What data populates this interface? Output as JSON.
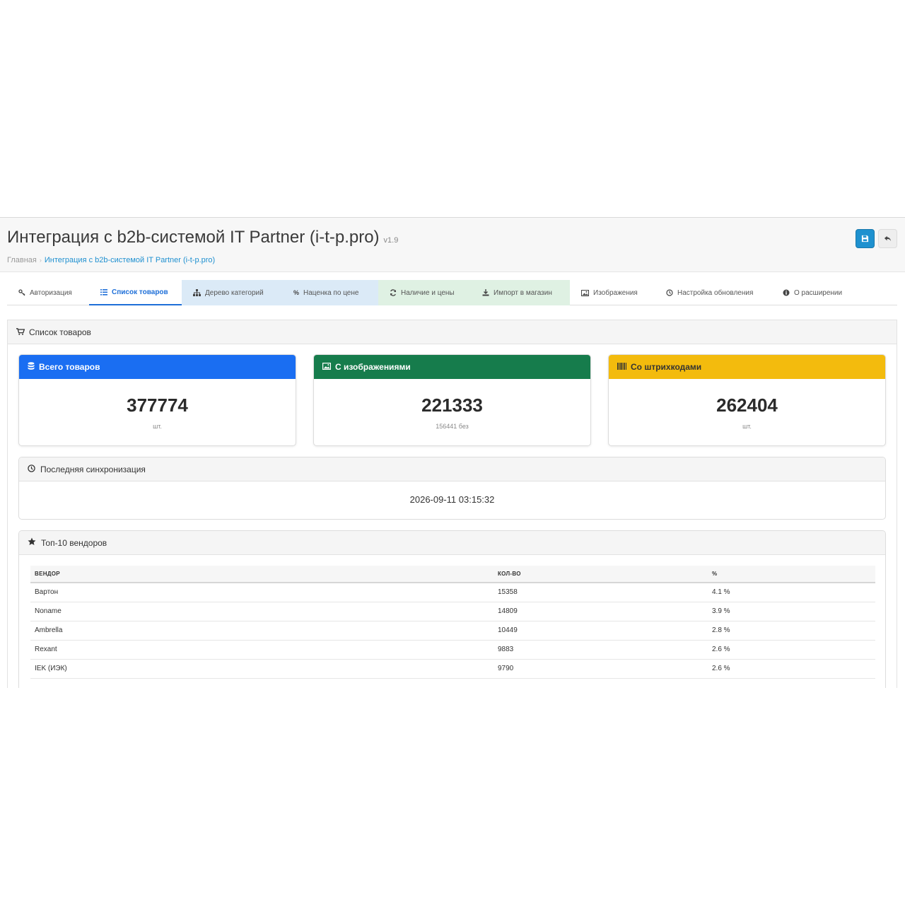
{
  "header": {
    "title": "Интеграция с b2b-системой IT Partner (i-t-p.pro)",
    "version": "v1.9",
    "breadcrumb": [
      "Главная",
      "Интеграция с b2b-системой IT Partner (i-t-p.pro)"
    ]
  },
  "tabs": [
    {
      "label": "Авторизация",
      "icon": "key-icon"
    },
    {
      "label": "Список товаров",
      "icon": "list-icon",
      "active": true
    },
    {
      "label": "Дерево категорий",
      "icon": "sitemap-icon"
    },
    {
      "label": "Наценка по цене",
      "icon": "percent-icon"
    },
    {
      "label": "Наличие и цены",
      "icon": "refresh-icon"
    },
    {
      "label": "Импорт в магазин",
      "icon": "download-icon"
    },
    {
      "label": "Изображения",
      "icon": "image-icon"
    },
    {
      "label": "Настройка обновления",
      "icon": "clock-icon"
    },
    {
      "label": "О расширении",
      "icon": "info-icon"
    }
  ],
  "panel": {
    "title": "Список товаров"
  },
  "cards": [
    {
      "title": "Всего товаров",
      "value": "377774",
      "sub": "шт.",
      "color": "#1a6ef2"
    },
    {
      "title": "С изображениями",
      "value": "221333",
      "sub": "156441 без",
      "color": "#167c4c"
    },
    {
      "title": "Со штрихкодами",
      "value": "262404",
      "sub": "шт.",
      "color": "#f3bb0d"
    }
  ],
  "sync": {
    "title": "Последняя синхронизация",
    "time": "2026-09-11 03:15:32"
  },
  "vendors": {
    "title": "Топ-10 вендоров",
    "headers": [
      "ВЕНДОР",
      "КОЛ-ВО",
      "%"
    ],
    "rows": [
      [
        "Вартон",
        "15358",
        "4.1 %"
      ],
      [
        "Noname",
        "14809",
        "3.9 %"
      ],
      [
        "Ambrella",
        "10449",
        "2.8 %"
      ],
      [
        "Rexant",
        "9883",
        "2.6 %"
      ],
      [
        "IEK (ИЭК)",
        "9790",
        "2.6 %"
      ]
    ]
  }
}
